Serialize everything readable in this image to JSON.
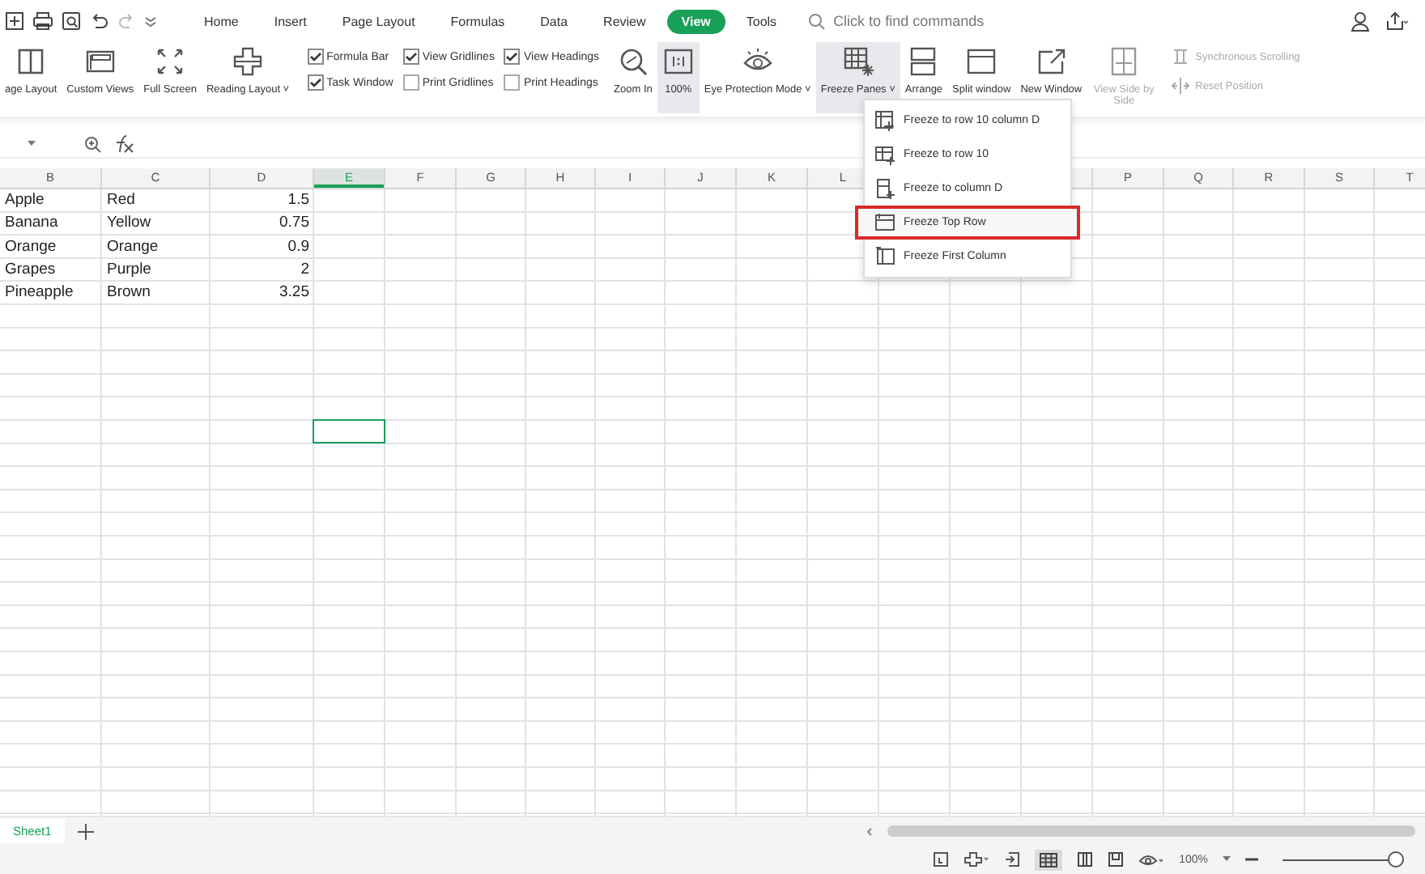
{
  "quick_access": {
    "tabs": [
      {
        "label": "Home",
        "selected": false
      },
      {
        "label": "Insert",
        "selected": false
      },
      {
        "label": "Page Layout",
        "selected": false
      },
      {
        "label": "Formulas",
        "selected": false
      },
      {
        "label": "Data",
        "selected": false
      },
      {
        "label": "Review",
        "selected": false
      },
      {
        "label": "View",
        "selected": true
      },
      {
        "label": "Tools",
        "selected": false
      }
    ],
    "search": {
      "placeholder": "Click to find commands"
    }
  },
  "ribbon": {
    "left_buttons": [
      {
        "label": "age Layout"
      },
      {
        "label": "Custom Views"
      },
      {
        "label": "Full Screen"
      },
      {
        "label": "Reading Layout ˅"
      }
    ],
    "checkboxes": [
      {
        "label": "Formula Bar",
        "checked": true
      },
      {
        "label": "Task Window",
        "checked": true
      },
      {
        "label": "View Gridlines",
        "checked": true
      },
      {
        "label": "Print Gridlines",
        "checked": false
      },
      {
        "label": "View Headings",
        "checked": true
      },
      {
        "label": "Print Headings",
        "checked": false
      }
    ],
    "right_buttons": [
      {
        "label": "Zoom In",
        "selected": false,
        "disabled": false
      },
      {
        "label": "100%",
        "selected": true,
        "disabled": false
      },
      {
        "label": "Eye Protection Mode ˅",
        "selected": false,
        "disabled": false
      },
      {
        "label": "Freeze Panes ˅",
        "selected": true,
        "disabled": false
      },
      {
        "label": "Arrange",
        "selected": false,
        "disabled": false
      },
      {
        "label": "Split window",
        "selected": false,
        "disabled": false
      },
      {
        "label": "New Window",
        "selected": false,
        "disabled": false
      },
      {
        "label": "View Side by Side",
        "selected": false,
        "disabled": true
      }
    ],
    "small_buttons": [
      {
        "label": "Synchronous Scrolling",
        "disabled": true
      },
      {
        "label": "Reset Position",
        "disabled": true
      }
    ]
  },
  "freeze_menu": {
    "items": [
      {
        "label": "Freeze to row 10 column D",
        "highlighted": false
      },
      {
        "label": "Freeze to row 10",
        "highlighted": false
      },
      {
        "label": "Freeze to column D",
        "highlighted": false
      },
      {
        "label": "Freeze Top Row",
        "highlighted": true
      },
      {
        "label": "Freeze First Column",
        "highlighted": false
      }
    ]
  },
  "sheet": {
    "columns": [
      {
        "label": "B",
        "selected": false
      },
      {
        "label": "C",
        "selected": false
      },
      {
        "label": "D",
        "selected": false,
        "numeric": true
      },
      {
        "label": "E",
        "selected": true
      },
      {
        "label": "F",
        "selected": false
      },
      {
        "label": "G",
        "selected": false
      },
      {
        "label": "H",
        "selected": false
      },
      {
        "label": "I",
        "selected": false
      },
      {
        "label": "J",
        "selected": false
      },
      {
        "label": "K",
        "selected": false
      },
      {
        "label": "L",
        "selected": false
      },
      {
        "label": "P",
        "selected": false
      },
      {
        "label": "Q",
        "selected": false
      },
      {
        "label": "R",
        "selected": false
      },
      {
        "label": "S",
        "selected": false
      },
      {
        "label": "T",
        "selected": false
      }
    ],
    "rows": [
      [
        "Apple",
        "Red",
        "1.5"
      ],
      [
        "Banana",
        "Yellow",
        "0.75"
      ],
      [
        "Orange",
        "Orange",
        "0.9"
      ],
      [
        "Grapes",
        "Purple",
        "2"
      ],
      [
        "Pineapple",
        "Brown",
        "3.25"
      ]
    ]
  },
  "sheet_tabs": [
    {
      "label": "Sheet1",
      "selected": true
    }
  ],
  "status_bar": {
    "zoom": "100%",
    "zoom_slider": {
      "level": 1
    }
  }
}
